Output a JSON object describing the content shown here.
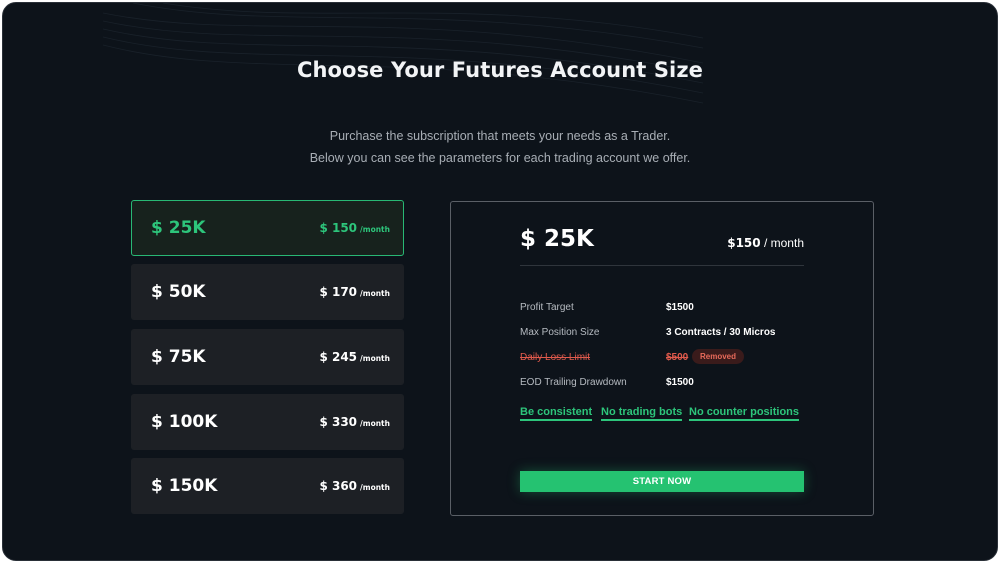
{
  "title": "Choose Your Futures Account Size",
  "subtitle_lines": [
    "Purchase the subscription that meets your needs as a Trader.",
    "Below you can see the parameters for each trading account we offer."
  ],
  "colors": {
    "accent": "#2dc57b",
    "background": "#0d131a",
    "card": "#1d2025",
    "danger": "#e05a4c"
  },
  "plans": [
    {
      "size": "$ 25K",
      "price": "$ 150",
      "per": "/month",
      "selected": true
    },
    {
      "size": "$ 50K",
      "price": "$ 170",
      "per": "/month",
      "selected": false
    },
    {
      "size": "$ 75K",
      "price": "$ 245",
      "per": "/month",
      "selected": false
    },
    {
      "size": "$ 100K",
      "price": "$ 330",
      "per": "/month",
      "selected": false
    },
    {
      "size": "$ 150K",
      "price": "$ 360",
      "per": "/month",
      "selected": false
    }
  ],
  "detail": {
    "size": "$ 25K",
    "price": "$150",
    "per": "/ month",
    "rows": [
      {
        "label": "Profit Target",
        "value": "$1500"
      },
      {
        "label": "Max Position Size",
        "value": "3 Contracts / 30 Micros"
      },
      {
        "label": "Daily Loss Limit",
        "value": "$500",
        "badge": "Removed"
      },
      {
        "label": "EOD Trailing Drawdown",
        "value": "$1500"
      }
    ],
    "rules": [
      "Be consistent",
      "No trading bots",
      "No counter positions"
    ],
    "cta": "START NOW"
  }
}
